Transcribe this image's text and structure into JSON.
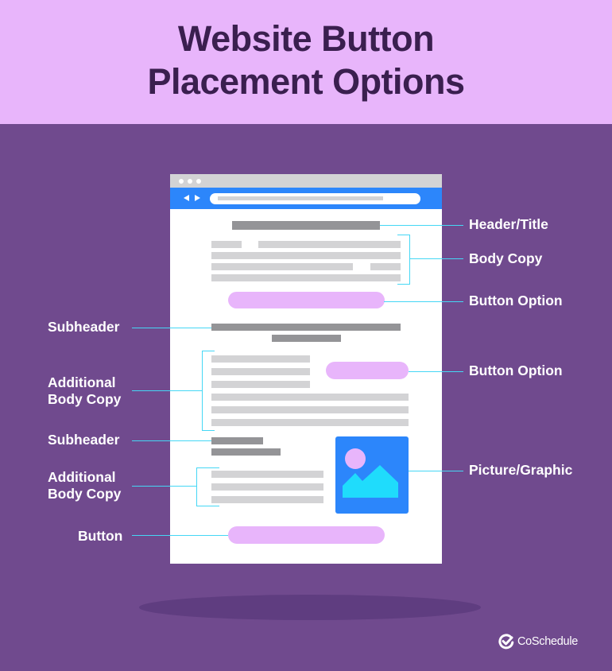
{
  "title": {
    "line1": "Website Button",
    "line2": "Placement Options"
  },
  "colors": {
    "header_bg": "#e8b5fb",
    "title_text": "#3a1f4f",
    "main_bg": "#704a8e",
    "browser_nav": "#2c86fb",
    "button_pill": "#e8b5fb",
    "connector_line": "#45d7f5",
    "dark_text_block": "#949497",
    "light_text_block": "#d3d3d5",
    "picture_mountain": "#1fdcfc",
    "picture_sun": "#e8b5fb"
  },
  "annotations": {
    "right": [
      {
        "label": "Header/Title"
      },
      {
        "label": "Body Copy"
      },
      {
        "label": "Button Option"
      },
      {
        "label": "Button Option"
      },
      {
        "label": "Picture/Graphic"
      }
    ],
    "left": [
      {
        "label": "Subheader"
      },
      {
        "label": "Additional",
        "label2": "Body Copy"
      },
      {
        "label": "Subheader"
      },
      {
        "label": "Additional",
        "label2": "Body Copy"
      },
      {
        "label": "Button"
      }
    ]
  },
  "icons": {
    "browser_back": "arrow-left-icon",
    "browser_forward": "arrow-right-icon",
    "picture": "image-icon",
    "brand": "checkmark-logo-icon"
  },
  "brand": {
    "name": "CoSchedule"
  }
}
